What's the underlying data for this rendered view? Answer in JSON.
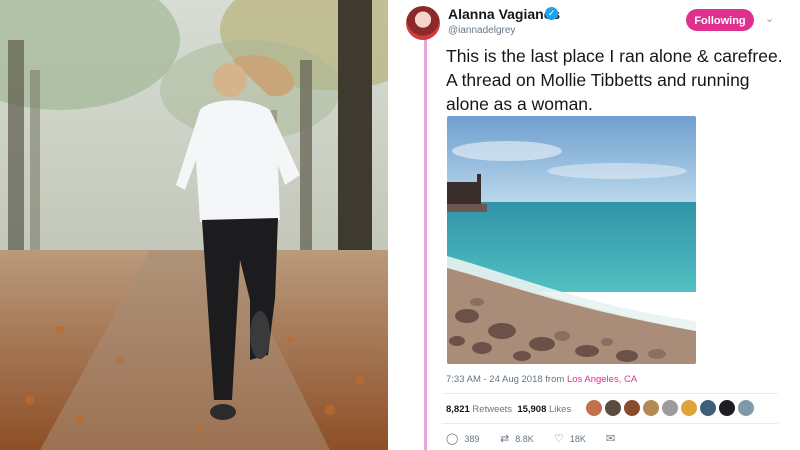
{
  "tweet": {
    "author_name": "Alanna Vagianos",
    "author_handle": "@iannadelgrey",
    "follow_label": "Following",
    "text": "This is the last place I ran alone & carefree. A thread on Mollie Tibbetts and running alone as a woman.",
    "timestamp": "7:33 AM - 24 Aug 2018 from ",
    "location": "Los Angeles, CA",
    "retweets_count": "8,821",
    "retweets_label": "Retweets",
    "likes_count": "15,908",
    "likes_label": "Likes",
    "reply_count": "389",
    "retweet_action_count": "8.8K",
    "like_action_count": "18K"
  },
  "colors": {
    "accent": "#e0308f",
    "thread_line": "#e9a6d9",
    "verified": "#1da1f2"
  },
  "icons": {
    "verified": "verified-badge-icon",
    "caret": "chevron-down-icon",
    "reply": "reply-icon",
    "retweet": "retweet-icon",
    "like": "heart-icon",
    "dm": "mail-icon"
  }
}
